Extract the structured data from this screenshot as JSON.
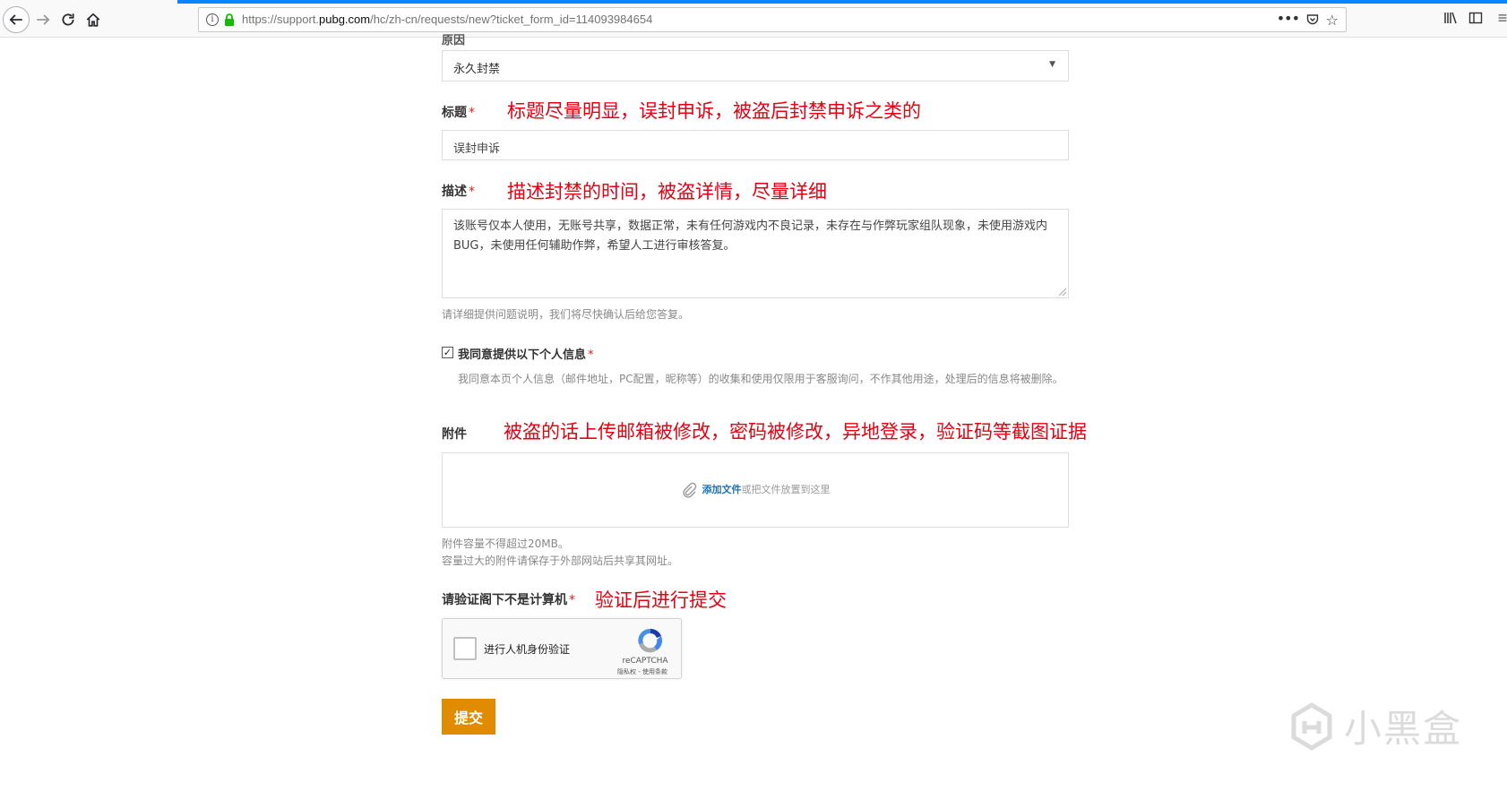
{
  "browser": {
    "url_prefix": "https://support.",
    "url_domain": "pubg.com",
    "url_path": "/hc/zh-cn/requests/new?ticket_form_id=114093984654",
    "more_label": "•••"
  },
  "form": {
    "cut_label": "原因",
    "ban_type_value": "永久封禁",
    "title_label": "标题",
    "title_annotation": "标题尽量明显，误封申诉，被盗后封禁申诉之类的",
    "title_value": "误封申诉",
    "desc_label": "描述",
    "desc_annotation": "描述封禁的时间，被盗详情，尽量详细",
    "desc_value": "该账号仅本人使用，无账号共享，数据正常，未有任何游戏内不良记录，未存在与作弊玩家组队现象，未使用游戏内BUG，未使用任何辅助作弊，希望人工进行审核答复。",
    "desc_hint": "请详细提供问题说明，我们将尽快确认后给您答复。",
    "consent_label": "我同意提供以下个人信息",
    "consent_detail": "我同意本页个人信息（邮件地址，PC配置，昵称等）的收集和使用仅限用于客服询问，不作其他用途，处理后的信息将被删除。",
    "attach_label": "附件",
    "attach_annotation": "被盗的话上传邮箱被修改，密码被修改，异地登录，验证码等截图证据",
    "attach_link": "添加文件",
    "attach_rest": "或把文件放置到这里",
    "attach_hint_1": "附件容量不得超过20MB。",
    "attach_hint_2": "容量过大的附件请保存于外部网站后共享其网址。",
    "captcha_label": "请验证阁下不是计算机",
    "captcha_annotation": "验证后进行提交",
    "captcha_text": "进行人机身份验证",
    "captcha_brand": "reCAPTCHA",
    "captcha_terms": "隐私权 - 使用条款",
    "required_mark": "*",
    "submit_label": "提交"
  },
  "watermark": "小黑盒",
  "colors": {
    "accent": "#e08b00",
    "annotation": "#e60012",
    "link": "#1f73b7",
    "progress": "#0a84ff"
  }
}
